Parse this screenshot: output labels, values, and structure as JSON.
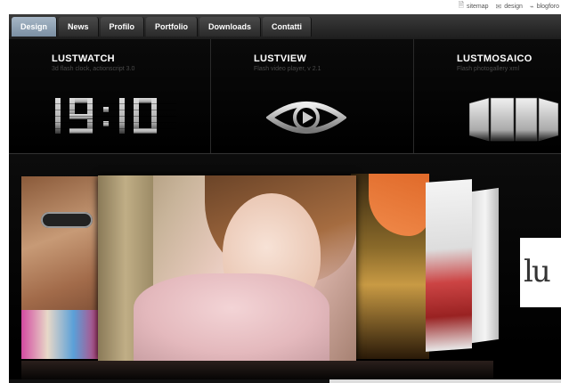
{
  "utility": {
    "links": [
      {
        "label": "sitemap",
        "icon": "page-icon"
      },
      {
        "label": "design",
        "icon": "mail-icon"
      },
      {
        "label": "blogforo",
        "icon": "rss-icon"
      }
    ]
  },
  "nav": {
    "tabs": [
      {
        "label": "Design",
        "active": true
      },
      {
        "label": "News"
      },
      {
        "label": "Profilo"
      },
      {
        "label": "Portfolio"
      },
      {
        "label": "Downloads"
      },
      {
        "label": "Contatti"
      }
    ]
  },
  "products": [
    {
      "title": "LUSTWATCH",
      "subtitle": "3d flash clock, actionscript 3.0",
      "icon": "clock-display-icon"
    },
    {
      "title": "LUSTVIEW",
      "subtitle": "Flash video player, v 2.1",
      "icon": "eye-play-icon"
    },
    {
      "title": "LUSTMOSAICO",
      "subtitle": "Flash photogallery xml",
      "icon": "mosaic-panels-icon"
    }
  ],
  "clock": {
    "text": "19:10"
  },
  "logo": {
    "text": "lu"
  }
}
